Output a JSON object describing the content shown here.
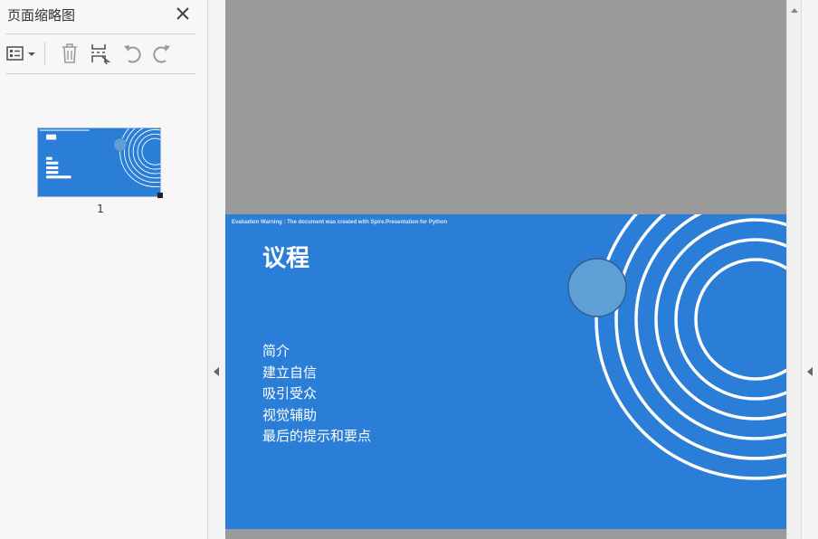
{
  "panel": {
    "title": "页面缩略图",
    "close_icon": "close-icon",
    "toolbar": {
      "options_icon": "thumbnail-options-icon",
      "delete_icon": "trash-icon",
      "insert_icon": "insert-page-icon",
      "rotate_ccw_icon": "rotate-counterclockwise-icon",
      "rotate_cw_icon": "rotate-clockwise-icon"
    },
    "thumbnails": [
      {
        "page_number": "1"
      }
    ]
  },
  "slide": {
    "warning": "Evaluation Warning : The document was created with Spire.Presentation for Python",
    "title": "议程",
    "items": [
      "简介",
      "建立自信",
      "吸引受众",
      "视觉辅助",
      "最后的提示和要点"
    ],
    "background_color": "#2b7ed8",
    "accent_circle_color": "#5f9fd5"
  },
  "colors": {
    "page_background": "#9a9a9a",
    "panel_background": "#f7f7f7"
  }
}
